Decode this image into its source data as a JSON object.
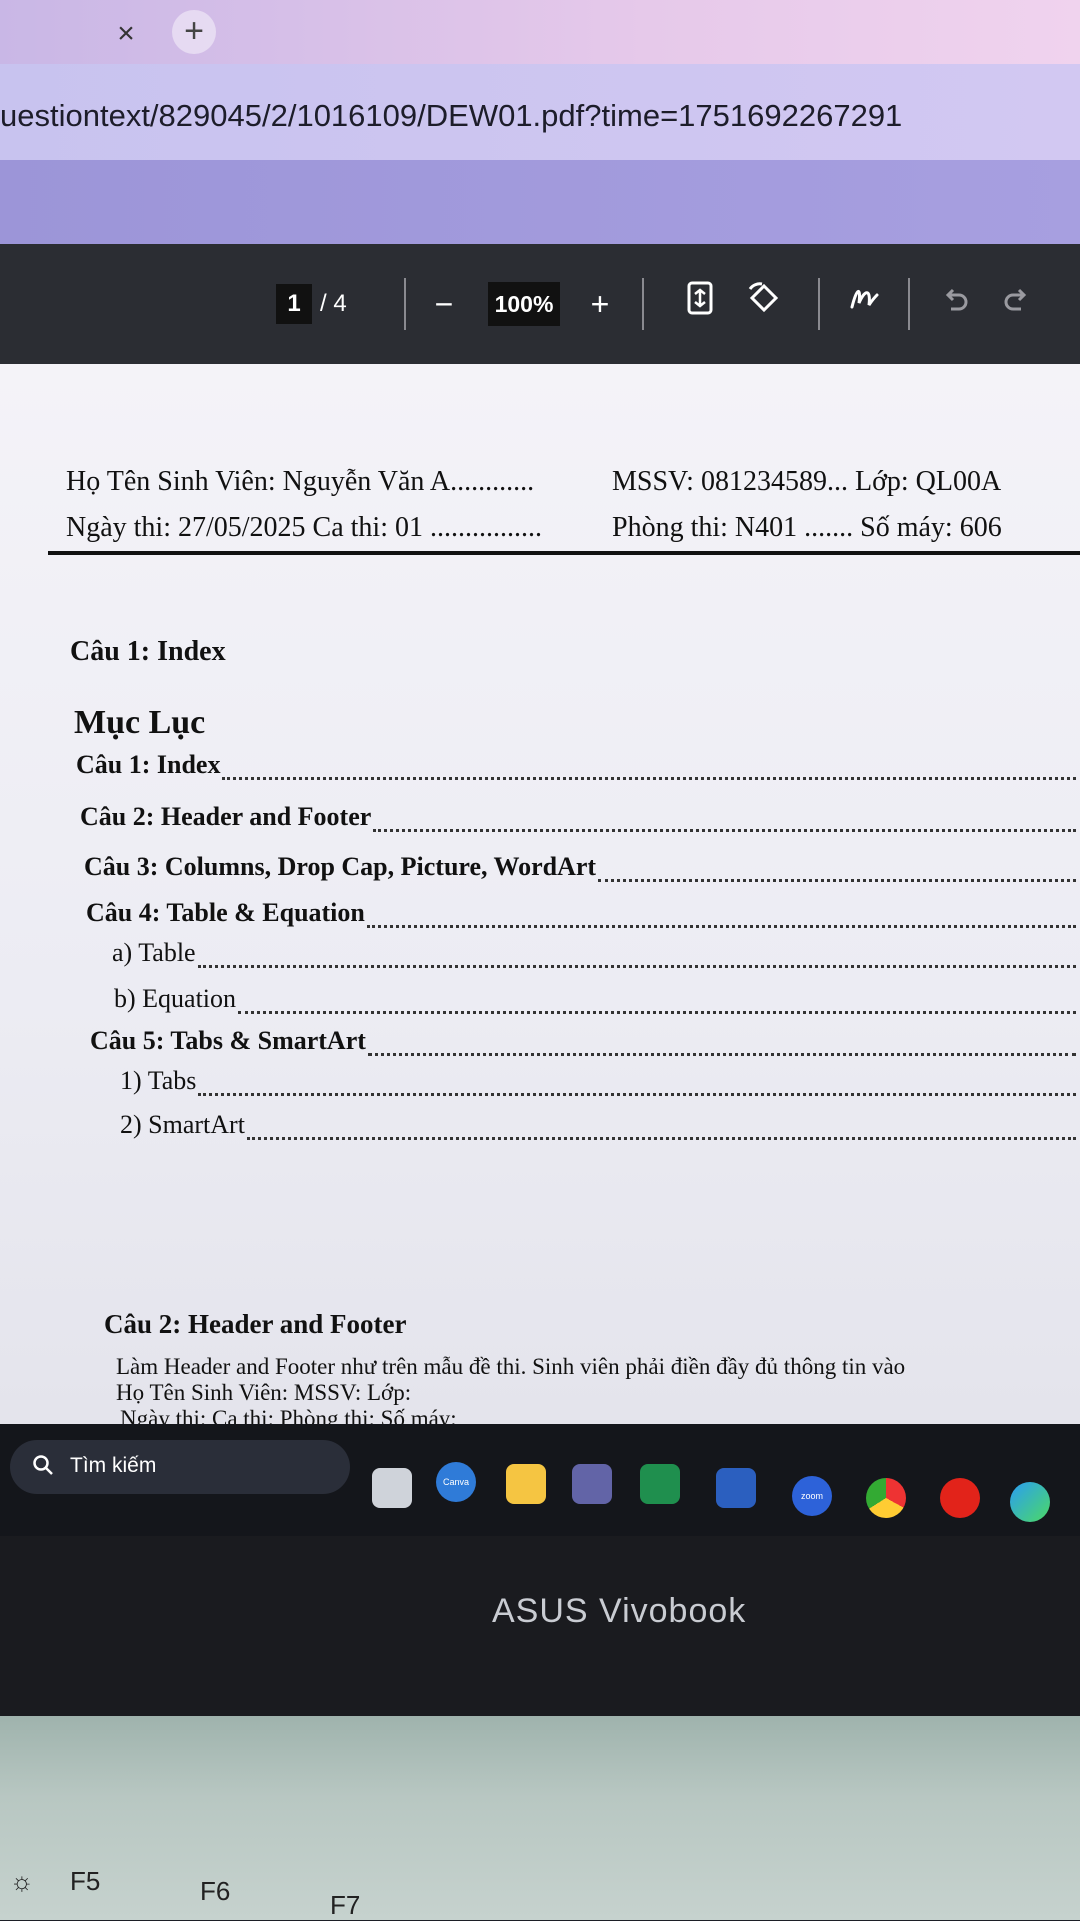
{
  "browser": {
    "tab_close": "×",
    "new_tab": "+",
    "url": "uestiontext/829045/2/1016109/DEW01.pdf?time=1751692267291"
  },
  "pdf_toolbar": {
    "current_page": "1",
    "total_pages": "/ 4",
    "zoom_out": "−",
    "zoom": "100%",
    "zoom_in": "+"
  },
  "document": {
    "header_line1_left": "Họ Tên Sinh Viên: Nguyễn Văn A............",
    "header_line1_right": "MSSV: 081234589... Lớp: QL00A",
    "header_line2_left": "Ngày thi: 27/05/2025 Ca thi: 01 ................",
    "header_line2_right": "Phòng thi: N401 ....... Số máy: 606",
    "q1_heading": "Câu 1: Index",
    "toc_title": "Mục Lục",
    "toc": [
      {
        "label": "Câu 1: Index"
      },
      {
        "label": "Câu 2: Header and Footer"
      },
      {
        "label": "Câu 3: Columns, Drop Cap, Picture, WordArt"
      },
      {
        "label": "Câu 4: Table & Equation"
      },
      {
        "label": "a)   Table"
      },
      {
        "label": "b)   Equation"
      },
      {
        "label": "Câu 5: Tabs & SmartArt"
      },
      {
        "label": "1)   Tabs"
      },
      {
        "label": "2)   SmartArt"
      }
    ],
    "q2_heading": "Câu 2: Header and Footer",
    "q2_line1": "Làm Header and Footer như trên mẫu đề thi. Sinh viên phải điền đầy đủ thông tin vào",
    "q2_line2": "Họ Tên Sinh Viên: MSSV: Lớp:",
    "q2_line3": "Ngày thi: Ca thi: Phòng thi: Số máy:"
  },
  "taskbar": {
    "search_placeholder": "Tìm kiếm",
    "apps": [
      "file-explorer",
      "canva",
      "folder",
      "teams",
      "excel",
      "word",
      "zoom",
      "chrome",
      "opera",
      "edge"
    ],
    "zoom_label": "zoom",
    "canva_label": "Canva"
  },
  "laptop": {
    "brand": "ASUS Vivobook",
    "keys": [
      "F5",
      "F6",
      "F7"
    ]
  }
}
